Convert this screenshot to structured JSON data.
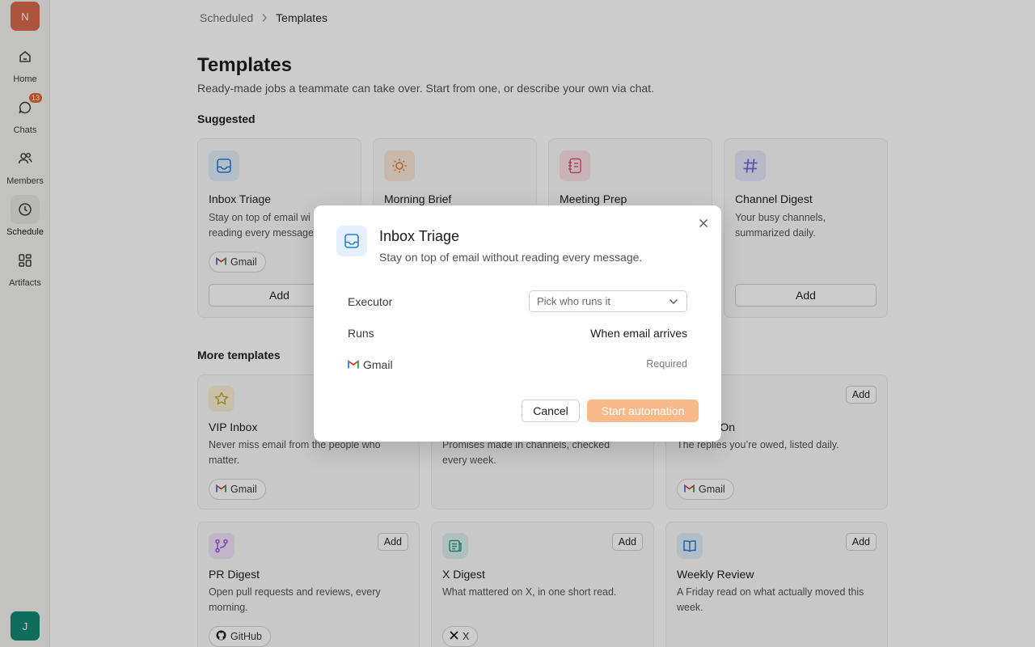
{
  "sidebar": {
    "workspace_initial": "N",
    "user_initial": "J",
    "items": [
      {
        "label": "Home",
        "icon": "home-icon"
      },
      {
        "label": "Chats",
        "icon": "chat-icon",
        "badge": "13"
      },
      {
        "label": "Members",
        "icon": "members-icon"
      },
      {
        "label": "Schedule",
        "icon": "clock-icon",
        "active": true
      },
      {
        "label": "Artifacts",
        "icon": "artifacts-icon"
      }
    ]
  },
  "breadcrumb": {
    "parent": "Scheduled",
    "current": "Templates"
  },
  "page": {
    "title": "Templates",
    "subtitle": "Ready-made jobs a teammate can take over. Start from one, or describe your own via chat."
  },
  "suggested": {
    "title": "Suggested",
    "cards": [
      {
        "title": "Inbox Triage",
        "desc1": "Stay on top of email wi",
        "desc2": "reading every message",
        "chip": "Gmail",
        "add": "Add",
        "icon": "inbox-icon",
        "color": "#2a7fd4"
      },
      {
        "title": "Morning Brief",
        "icon": "sun-icon",
        "color": "#e07a3a"
      },
      {
        "title": "Meeting Prep",
        "icon": "notebook-icon",
        "color": "#d9577a"
      },
      {
        "title": "Channel Digest",
        "desc1": "Your busy channels,",
        "desc2": "summarized daily.",
        "add": "Add",
        "icon": "hash-icon",
        "color": "#6b6fd8"
      }
    ]
  },
  "more": {
    "title": "More templates",
    "cards": [
      {
        "title": "VIP Inbox",
        "desc1": "Never miss email from the people who",
        "desc2": "matter.",
        "chip": "Gmail",
        "icon": "star-icon",
        "color": "#c9a83a"
      },
      {
        "desc1": "Promises made in channels, checked",
        "desc2": "every week."
      },
      {
        "title": "On",
        "desc1": "The replies you’re owed, listed daily.",
        "chip": "Gmail",
        "add": "Add"
      },
      {
        "title": "PR Digest",
        "desc1": "Open pull requests and reviews, every",
        "desc2": "morning.",
        "chip": "GitHub",
        "add": "Add",
        "icon": "git-icon",
        "color": "#9b57d0"
      },
      {
        "title": "X Digest",
        "desc1": "What mattered on X, in one short read.",
        "chip": "X",
        "add": "Add",
        "icon": "news-icon",
        "color": "#2e9a8a"
      },
      {
        "title": "Weekly Review",
        "desc1": "A Friday read on what actually moved this",
        "desc2": "week.",
        "add": "Add",
        "icon": "book-icon",
        "color": "#2a7fd4"
      }
    ]
  },
  "modal": {
    "title": "Inbox Triage",
    "subtitle": "Stay on top of email without reading every message.",
    "executor_label": "Executor",
    "executor_placeholder": "Pick who runs it",
    "runs_label": "Runs",
    "runs_value": "When email arrives",
    "integration": "Gmail",
    "integration_status": "Required",
    "cancel": "Cancel",
    "start": "Start automation",
    "accent": "#f7b989"
  }
}
